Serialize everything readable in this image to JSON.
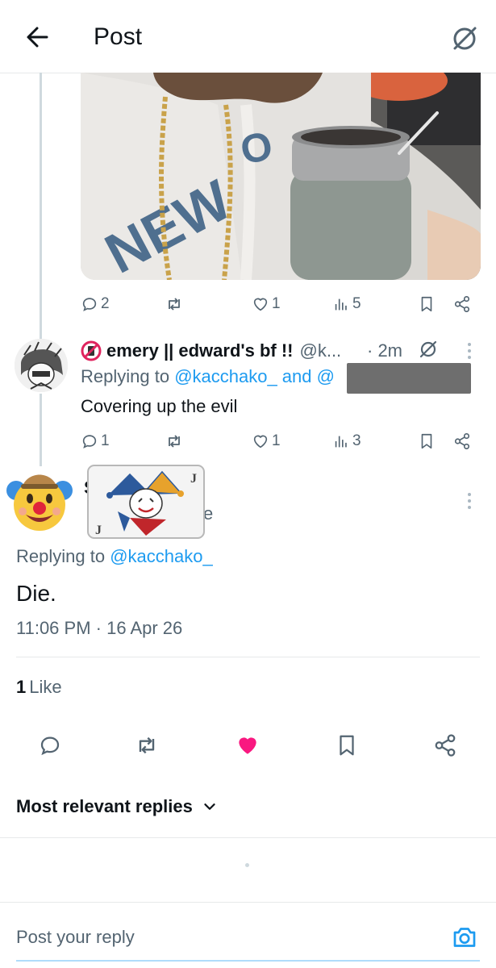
{
  "header": {
    "title": "Post",
    "back_icon": "arrow-left-icon",
    "grok_icon": "grok-icon"
  },
  "media_tweet": {
    "actions": {
      "replies": "2",
      "reposts": "",
      "likes": "1",
      "views": "5"
    }
  },
  "reply_tweet": {
    "name": "emery || edward's bf !!",
    "handle": "@k...",
    "time": "· 2m",
    "replying_prefix": "Replying to ",
    "replying_links": "@kacchako_ and @",
    "text": "Covering up the evil",
    "actions": {
      "replies": "1",
      "reposts": "",
      "likes": "1",
      "views": "3"
    }
  },
  "main_tweet": {
    "name_partial": "S",
    "handle_partial": "e",
    "replying_prefix": "Replying to ",
    "replying_link": "@kacchako_",
    "text": "Die.",
    "timestamp": "11:06 PM · 16 Apr 26",
    "likes_count": "1",
    "likes_label": "Like"
  },
  "replies_section": {
    "sort_label": "Most relevant replies"
  },
  "composer": {
    "placeholder": "Post your reply"
  },
  "colors": {
    "accent": "#1d9bf0",
    "like": "#f91880",
    "secondary_text": "#536471",
    "border": "#e7e9ea"
  }
}
